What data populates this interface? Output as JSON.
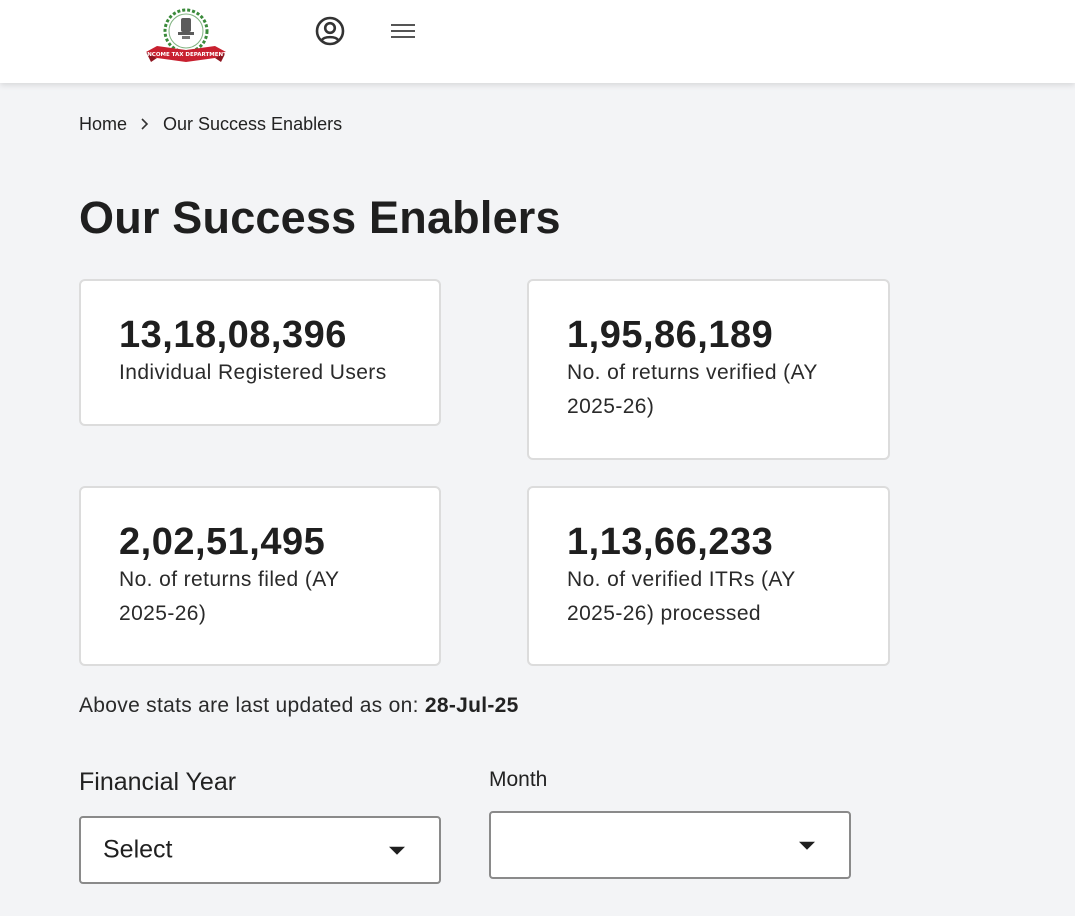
{
  "header": {
    "logo_text": "INCOME TAX DEPARTMENT",
    "profile_icon": "account-circle-icon",
    "menu_icon": "hamburger-menu-icon"
  },
  "breadcrumb": {
    "home": "Home",
    "separator_icon": "chevron-right-icon",
    "current": "Our Success Enablers"
  },
  "page": {
    "title": "Our Success Enablers"
  },
  "stats": [
    {
      "value": "13,18,08,396",
      "label": "Individual Registered Users"
    },
    {
      "value": "1,95,86,189",
      "label": "No. of returns verified (AY 2025-26)"
    },
    {
      "value": "2,02,51,495",
      "label": "No. of returns filed (AY 2025-26)"
    },
    {
      "value": "1,13,66,233",
      "label": "No. of verified ITRs (AY 2025-26) processed"
    }
  ],
  "updated": {
    "prefix": "Above stats are last updated as on:",
    "date": "28-Jul-25"
  },
  "filters": {
    "financial_year": {
      "label": "Financial Year",
      "value": "Select"
    },
    "month": {
      "label": "Month",
      "value": ""
    }
  },
  "colors": {
    "page_bg": "#f3f4f6",
    "card_border": "#dcdcdc",
    "logo_red": "#c8202f",
    "logo_green": "#3a8a3a"
  }
}
